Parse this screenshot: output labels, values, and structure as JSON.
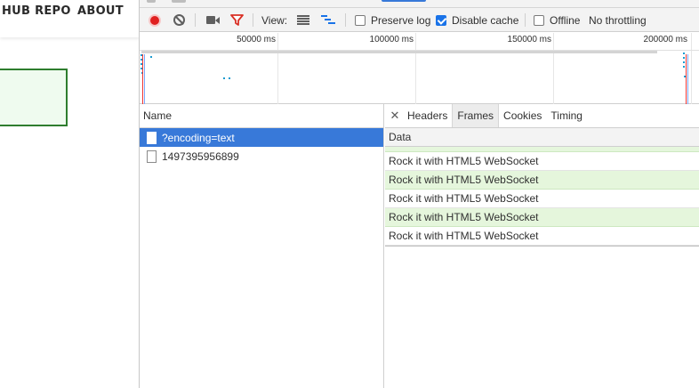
{
  "page": {
    "nav": [
      "HUB REPO",
      "ABOUT"
    ]
  },
  "toolbar": {
    "view_label": "View:",
    "preserve_log": {
      "label": "Preserve log",
      "checked": false
    },
    "disable_cache": {
      "label": "Disable cache",
      "checked": true
    },
    "offline": {
      "label": "Offline",
      "checked": false
    },
    "throttling": "No throttling"
  },
  "overview": {
    "ticks": [
      "50000 ms",
      "100000 ms",
      "150000 ms",
      "200000 ms"
    ]
  },
  "requests": {
    "header": "Name",
    "items": [
      {
        "name": "?encoding=text",
        "selected": true
      },
      {
        "name": "1497395956899",
        "selected": false
      }
    ]
  },
  "detail": {
    "tabs": [
      "Headers",
      "Frames",
      "Cookies",
      "Timing"
    ],
    "active_tab": "Frames",
    "frames_header": "Data",
    "frames": [
      "Rock it with HTML5 WebSocket",
      "Rock it with HTML5 WebSocket",
      "Rock it with HTML5 WebSocket",
      "Rock it with HTML5 WebSocket",
      "Rock it with HTML5 WebSocket"
    ]
  },
  "colors": {
    "selection": "#3879d9",
    "record": "#e02020",
    "filter": "#d93025",
    "frame_green": "#e5f6dc"
  }
}
